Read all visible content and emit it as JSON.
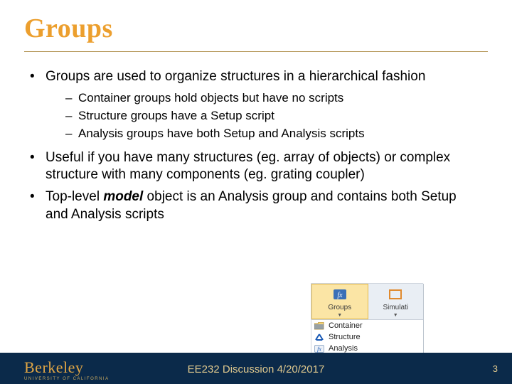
{
  "title": "Groups",
  "bullets": [
    {
      "text": "Groups are used to organize structures in a hierarchical fashion",
      "sub": [
        "Container groups hold objects but have no scripts",
        "Structure groups have a Setup script",
        "Analysis groups have both Setup and Analysis scripts"
      ]
    },
    {
      "text": "Useful if you have many structures (eg. array of objects) or complex structure with many components (eg. grating coupler)",
      "sub": []
    },
    {
      "text_pre": "Top-level ",
      "text_emph": "model",
      "text_post": " object is an Analysis group and contains both Setup and Analysis scripts",
      "sub": []
    }
  ],
  "ribbon": {
    "groups_label": "Groups",
    "simulation_label": "Simulati",
    "menu": [
      "Container",
      "Structure",
      "Analysis"
    ]
  },
  "footer": {
    "logo_word": "Berkeley",
    "logo_tag": "UNIVERSITY OF CALIFORNIA",
    "center": "EE232 Discussion 4/20/2017",
    "page": "3"
  }
}
